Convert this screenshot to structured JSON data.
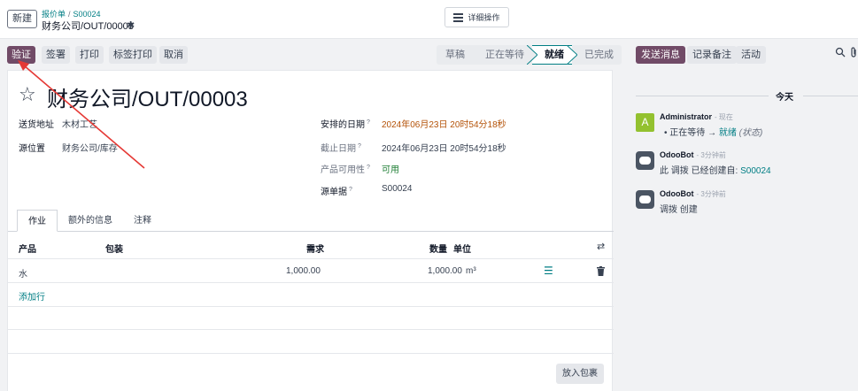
{
  "topbar": {
    "new_label": "新建",
    "breadcrumb_parent": "报价单",
    "breadcrumb_sep": "/",
    "breadcrumb_ref": "S00024",
    "breadcrumb_current": "财务公司/OUT/00003",
    "action_menu_label": "详细操作"
  },
  "statusbar": {
    "buttons": [
      "验证",
      "签署",
      "打印",
      "标签打印",
      "取消"
    ],
    "stages": [
      "草稿",
      "正在等待",
      "就绪",
      "已完成"
    ],
    "active_stage": "就绪"
  },
  "form": {
    "title": "财务公司/OUT/00003",
    "left_fields": [
      {
        "label": "送货地址",
        "value": "木材工艺"
      },
      {
        "label": "源位置",
        "value": "财务公司/库存"
      }
    ],
    "right_fields": [
      {
        "label": "安排的日期",
        "value": "2024年06月23日 20时54分18秒"
      },
      {
        "label": "截止日期",
        "value": "2024年06月23日 20时54分18秒"
      },
      {
        "label": "产品可用性",
        "value": "可用"
      },
      {
        "label": "源单据",
        "value": "S00024"
      }
    ],
    "help_mark": "?",
    "tabs": [
      "作业",
      "额外的信息",
      "注释"
    ],
    "columns": {
      "product": "产品",
      "packaging": "包装",
      "demand": "需求",
      "quantity": "数量",
      "uom": "单位"
    },
    "rows": [
      {
        "product": "水",
        "demand": "1,000.00",
        "quantity": "1,000.00",
        "uom": "m³"
      }
    ],
    "add_line": "添加行",
    "put_in_pack": "放入包裹"
  },
  "chatter": {
    "send_message": "发送消息",
    "log_note": "记录备注",
    "activities": "活动",
    "day_label": "今天",
    "messages": [
      {
        "author": "Administrator",
        "time": "- 现在",
        "from": "正在等待",
        "arrow": "→",
        "to": "就绪",
        "field": "(状态)"
      },
      {
        "author": "OdooBot",
        "time": "- 3分钟前",
        "text": "此 调拨 已经创建自: ",
        "ref": "S00024"
      },
      {
        "author": "OdooBot",
        "time": "- 3分钟前",
        "text": "调拨 创建"
      }
    ]
  },
  "colors": {
    "primary": "#714b67",
    "accent": "#017e84",
    "annotation_arrow": "#e53935"
  }
}
